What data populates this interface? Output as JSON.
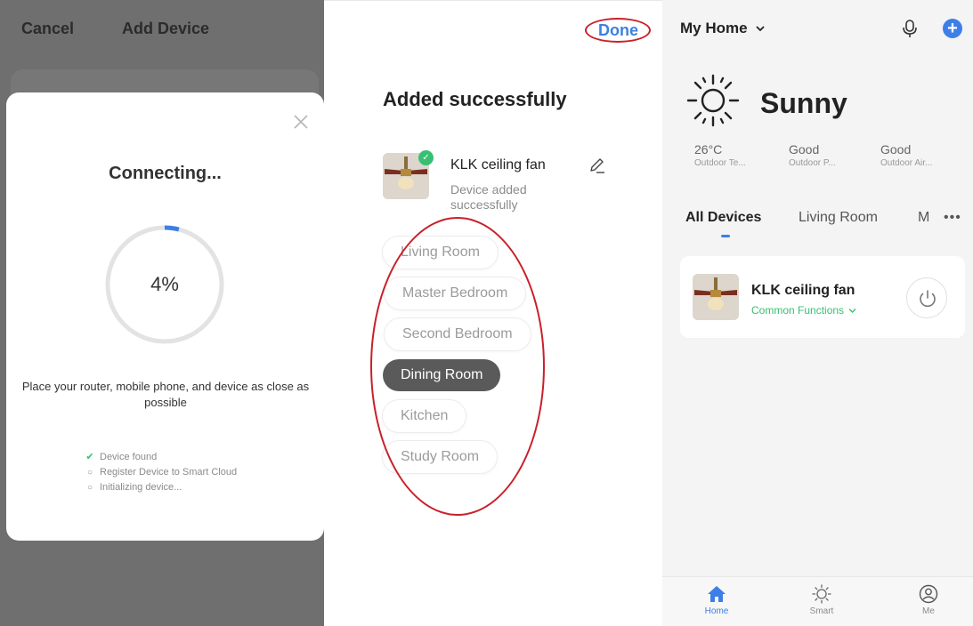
{
  "add_device": {
    "cancel_label": "Cancel",
    "title": "Add Device",
    "dialog": {
      "status_title": "Connecting...",
      "progress_text": "4%",
      "progress_value": 4,
      "hint": "Place your router, mobile phone, and device as close as possible",
      "steps": [
        {
          "label": "Device found",
          "state": "done"
        },
        {
          "label": "Register Device to Smart Cloud",
          "state": "pending"
        },
        {
          "label": "Initializing device...",
          "state": "pending"
        }
      ]
    }
  },
  "added": {
    "done_label": "Done",
    "heading": "Added successfully",
    "device": {
      "name": "KLK ceiling fan",
      "status": "Device added successfully"
    },
    "rooms": [
      {
        "label": "Living Room",
        "selected": false
      },
      {
        "label": "Master Bedroom",
        "selected": false
      },
      {
        "label": "Second Bedroom",
        "selected": false
      },
      {
        "label": "Dining Room",
        "selected": true
      },
      {
        "label": "Kitchen",
        "selected": false
      },
      {
        "label": "Study Room",
        "selected": false
      }
    ]
  },
  "home": {
    "home_selector": "My Home",
    "weather": {
      "condition": "Sunny",
      "stats": [
        {
          "value": "26°C",
          "label": "Outdoor Te..."
        },
        {
          "value": "Good",
          "label": "Outdoor P..."
        },
        {
          "value": "Good",
          "label": "Outdoor Air..."
        }
      ]
    },
    "tabs": [
      {
        "label": "All Devices",
        "active": true
      },
      {
        "label": "Living Room",
        "active": false
      },
      {
        "label": "M",
        "active": false
      }
    ],
    "more_label": "•••",
    "device_card": {
      "name": "KLK ceiling fan",
      "function_label": "Common Functions"
    },
    "nav": [
      {
        "label": "Home",
        "icon": "home-icon",
        "active": true
      },
      {
        "label": "Smart",
        "icon": "sun-icon",
        "active": false
      },
      {
        "label": "Me",
        "icon": "user-icon",
        "active": false
      }
    ]
  },
  "colors": {
    "accent_blue": "#3d7fe6",
    "success_green": "#37c071",
    "annotation_red": "#c8202a",
    "selected_room": "#5a5a5a"
  }
}
